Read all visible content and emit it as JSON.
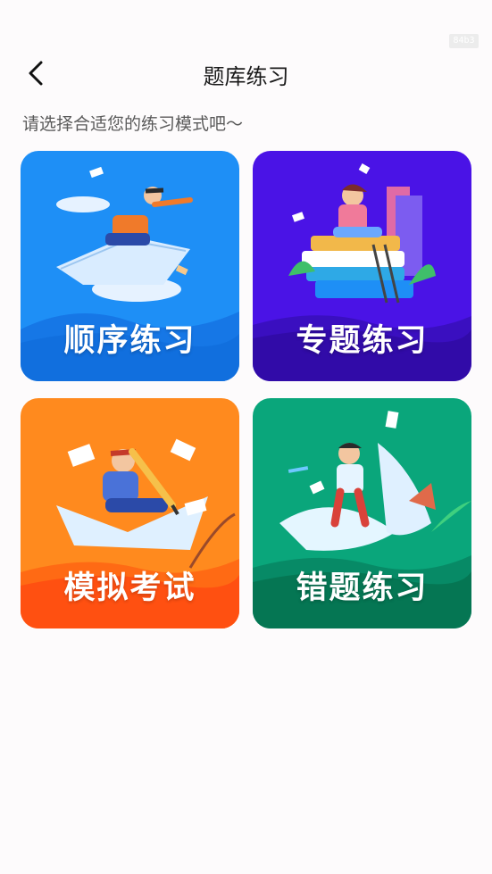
{
  "status": {
    "badge": "84b3"
  },
  "header": {
    "title": "题库练习",
    "back_icon": "chevron-left-icon"
  },
  "subtitle": "请选择合适您的练习模式吧～",
  "cards": [
    {
      "label": "顺序练习",
      "color": "#1e8ff6"
    },
    {
      "label": "专题练习",
      "color": "#4a13e6"
    },
    {
      "label": "模拟考试",
      "color": "#ff8a1e"
    },
    {
      "label": "错题练习",
      "color": "#0aa67b"
    }
  ]
}
